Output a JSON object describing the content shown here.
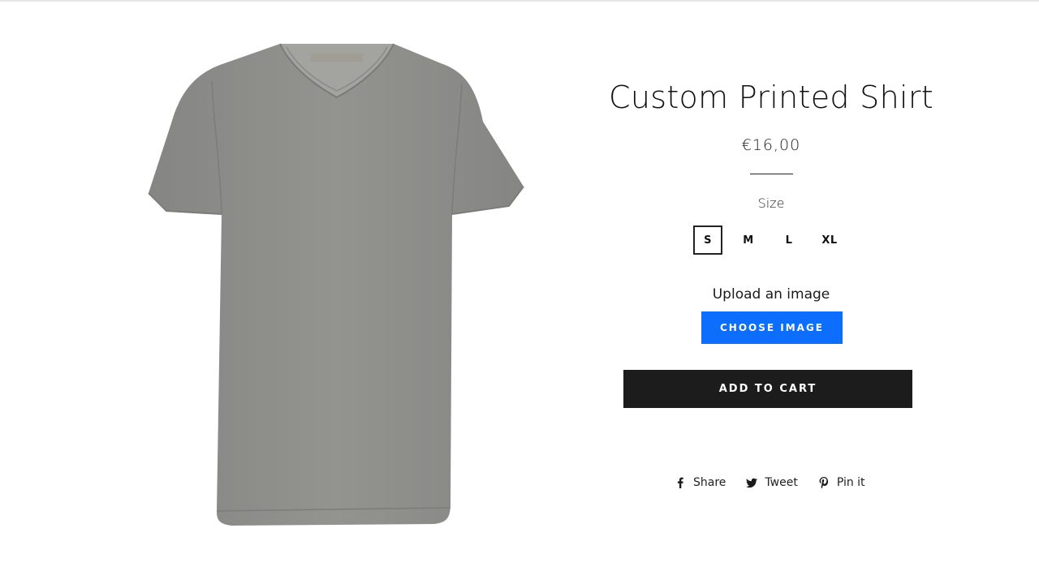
{
  "product": {
    "title": "Custom Printed Shirt",
    "price": "€16,00",
    "image_icon": "grey-v-neck-tshirt",
    "colors": {
      "shirt": "#8f8f8d",
      "accent_button": "#0d6efd",
      "cart_button": "#1c1c1c"
    }
  },
  "size": {
    "label": "Size",
    "selected": "S",
    "options": [
      "S",
      "M",
      "L",
      "XL"
    ]
  },
  "upload": {
    "label": "Upload an image",
    "button_label": "CHOOSE IMAGE"
  },
  "cart": {
    "button_label": "ADD TO CART"
  },
  "social": [
    {
      "label": "Share",
      "icon": "facebook-icon"
    },
    {
      "label": "Tweet",
      "icon": "twitter-icon"
    },
    {
      "label": "Pin it",
      "icon": "pinterest-icon"
    }
  ]
}
